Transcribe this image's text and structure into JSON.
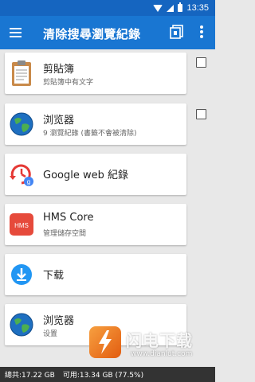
{
  "status_bar": {
    "time": "13:35"
  },
  "app_bar": {
    "title": "清除搜尋瀏覽紀錄"
  },
  "items": [
    {
      "name": "剪貼簿",
      "sub": "剪貼簿中有文字",
      "icon": "clipboard-icon"
    },
    {
      "name": "浏览器",
      "sub": "9 瀏覽紀錄 (書籤不會被清除)",
      "icon": "globe-icon"
    },
    {
      "name": "Google web 紀錄",
      "sub": "",
      "icon": "google-history-icon"
    },
    {
      "name": "HMS Core",
      "sub": "管理儲存空間",
      "icon": "hms-core-icon",
      "icon_text": "HMS"
    },
    {
      "name": "下载",
      "sub": "",
      "icon": "download-icon"
    },
    {
      "name": "浏览器",
      "sub": "设置",
      "icon": "globe-icon"
    }
  ],
  "footer": {
    "total": "總共:17.22 GB",
    "available": "可用:13.34 GB (77.5%)"
  },
  "watermark": {
    "title": "闪电下载",
    "url": "www.dianlut.com"
  },
  "colors": {
    "status_bar": "#1565c0",
    "app_bar": "#1976d2",
    "footer": "#333333",
    "download_blue": "#2196f3",
    "hms_red": "#e64a3b"
  }
}
